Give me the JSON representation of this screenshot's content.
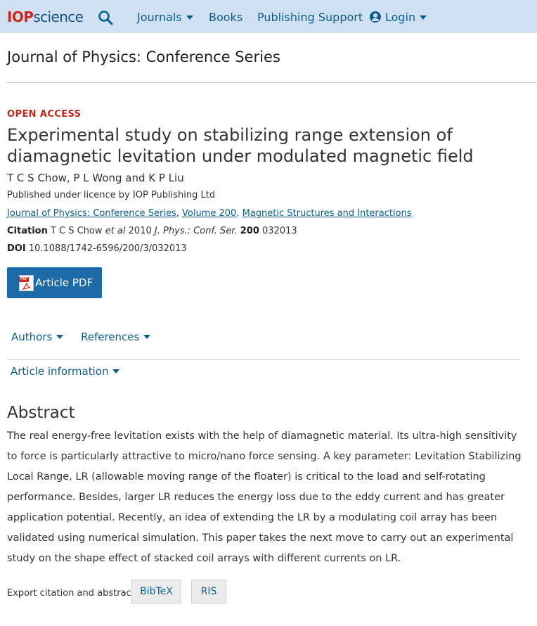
{
  "header": {
    "logo_iop": "IOP",
    "logo_science": "science",
    "search_icon": "search-icon",
    "nav": {
      "journals": "Journals",
      "books": "Books",
      "publishing_support": "Publishing Support",
      "login": "Login"
    },
    "background": "#cfe0f3",
    "link_color": "#0b5f8a"
  },
  "journal_title": "Journal of Physics: Conference Series",
  "article": {
    "open_access": "OPEN ACCESS",
    "title": "Experimental study on stabilizing range extension of diamagnetic levitation under modulated magnetic field",
    "authors": "T C S Chow, P L Wong and K P Liu",
    "licence": "Published under licence by IOP Publishing Ltd",
    "breadcrumbs": {
      "journal": "Journal of Physics: Conference Series",
      "volume": "Volume 200",
      "section": "Magnetic Structures and Interactions",
      "separator": ","
    },
    "citation": {
      "label": "Citation",
      "authors": "T C S Chow",
      "etal": "et al",
      "year": "2010",
      "journal": "J. Phys.: Conf. Ser.",
      "volume": "200",
      "number": "032013"
    },
    "doi": {
      "label": "DOI",
      "value": "10.1088/1742-6596/200/3/032013"
    },
    "pdf_button": "Article PDF",
    "pdf_icon_tag": "PDF"
  },
  "sections": {
    "authors": "Authors",
    "references": "References",
    "article_information": "Article information"
  },
  "abstract": {
    "heading": "Abstract",
    "text": "The real energy-free levitation exists with the help of diamagnetic material. Its ultra-high sensitivity to force is particularly attractive to micro/nano force sensing. A key parameter: Levitation Stabilizing Local Range, LR (allowable moving range of the floater) is critical to the load and self-rotating performance. Besides, larger LR reduces the energy loss due to the eddy current and has greater application potential. Recently, an idea of extending the LR by a modulating coil array has been validated using numerical simulation. This paper takes the next move to carry out an experimental study on the shape effect of stacked coil arrays with different currents on LR."
  },
  "export": {
    "label": "Export citation and abstract",
    "bibtex": "BibTeX",
    "ris": "RIS"
  },
  "colors": {
    "open_access": "#c0271f",
    "pdf_button": "#1c6aa8",
    "logo_red": "#d0271d",
    "logo_blue": "#1c4e80"
  }
}
